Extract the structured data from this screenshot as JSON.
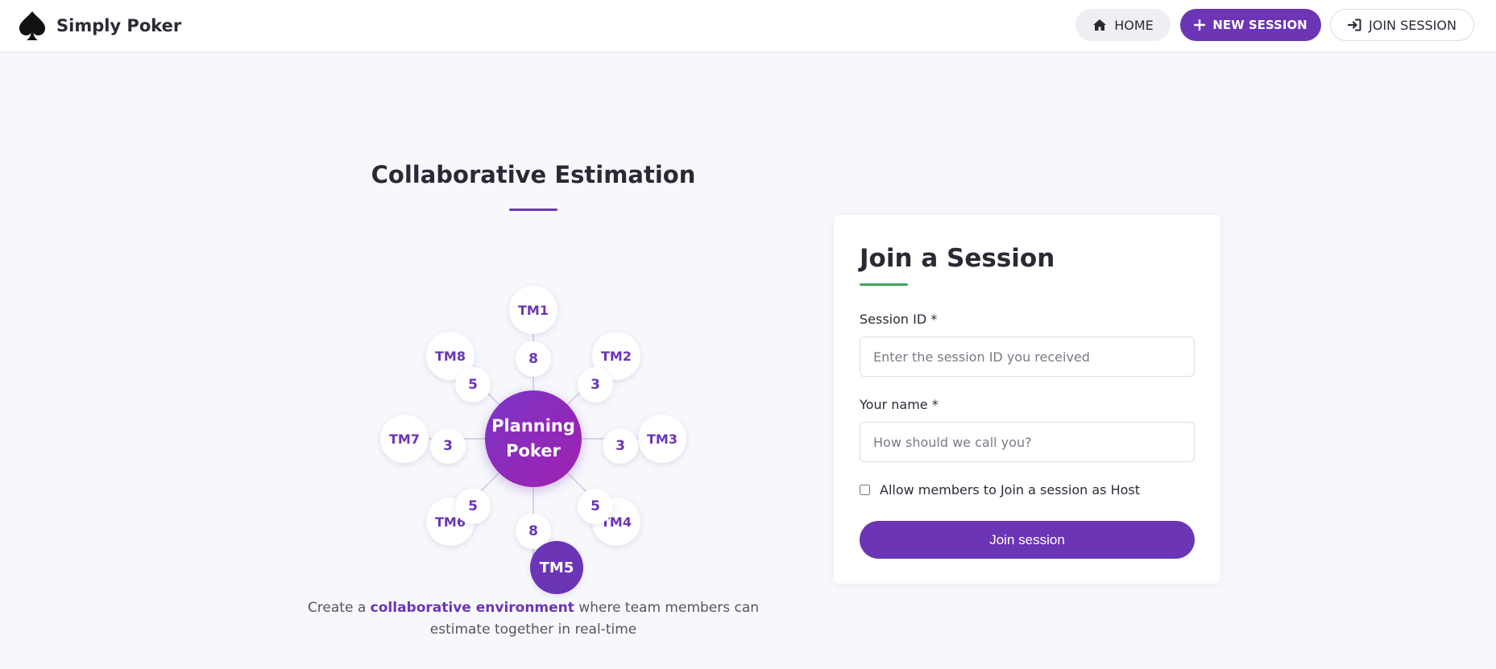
{
  "brand": {
    "name": "Simply Poker",
    "icon": "spade-icon"
  },
  "nav": {
    "home_label": "HOME",
    "new_session_label": "NEW SESSION",
    "join_session_label": "JOIN SESSION"
  },
  "hero": {
    "title": "Collaborative Estimation",
    "center_line1": "Planning",
    "center_line2": "Poker",
    "members": [
      {
        "label": "TM1",
        "vote": "8"
      },
      {
        "label": "TM2",
        "vote": "3"
      },
      {
        "label": "TM3",
        "vote": "3"
      },
      {
        "label": "TM4",
        "vote": "5"
      },
      {
        "label": "TM5",
        "vote": "8"
      },
      {
        "label": "TM6",
        "vote": "5"
      },
      {
        "label": "TM7",
        "vote": "3"
      },
      {
        "label": "TM8",
        "vote": "5"
      }
    ],
    "desc_before": "Create a ",
    "desc_accent": "collaborative environment",
    "desc_after": " where team members can estimate together in real-time"
  },
  "form": {
    "title": "Join a Session",
    "session_id_label": "Session ID *",
    "session_id_placeholder": "Enter the session ID you received",
    "name_label": "Your name *",
    "name_placeholder": "How should we call you?",
    "host_checkbox_label": "Allow members to Join a session as Host",
    "submit_label": "Join session"
  },
  "colors": {
    "accent": "#6b35b5",
    "success_underline": "#3aa85a",
    "background": "#f7f8fc"
  }
}
